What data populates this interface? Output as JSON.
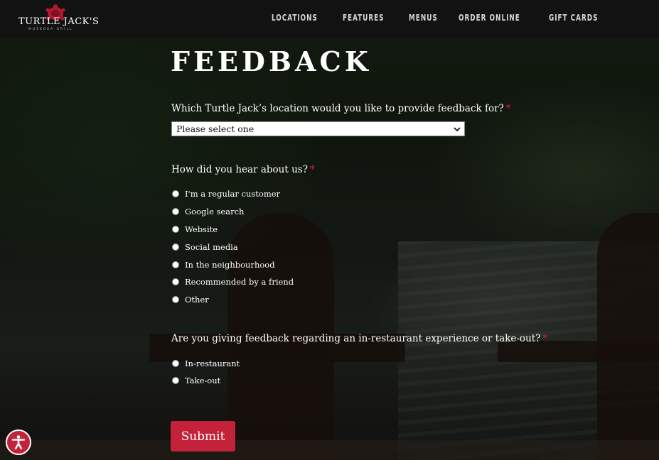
{
  "brand": {
    "name": "TURTLE JACK'S",
    "tagline": "MUSKOKA GRILL"
  },
  "nav": {
    "items": [
      {
        "label": "LOCATIONS"
      },
      {
        "label": "FEATURES"
      },
      {
        "label": "MENUS"
      },
      {
        "label": "ORDER ONLINE"
      },
      {
        "label": "GIFT CARDS"
      }
    ]
  },
  "form": {
    "title": "FEEDBACK",
    "location_question": {
      "label": "Which Turtle Jack’s location would you like to provide feedback for?",
      "required_mark": "*"
    },
    "location_select": {
      "value": "Please select one"
    },
    "hear_question": {
      "label": "How did you hear about us?",
      "required_mark": "*",
      "options": [
        {
          "label": "I'm a regular customer",
          "checked": false
        },
        {
          "label": "Google search",
          "checked": false
        },
        {
          "label": "Website",
          "checked": false
        },
        {
          "label": "Social media",
          "checked": false
        },
        {
          "label": "In the neighbourhood",
          "checked": false
        },
        {
          "label": "Recommended by a friend",
          "checked": false
        },
        {
          "label": "Other",
          "checked": false
        }
      ]
    },
    "experience_question": {
      "label": "Are you giving feedback regarding an in-restaurant experience or take-out?",
      "required_mark": "*",
      "options": [
        {
          "label": "In-restaurant",
          "checked": false
        },
        {
          "label": "Take-out",
          "checked": false
        }
      ]
    },
    "submit_label": "Submit"
  },
  "colors": {
    "accent": "#c4213a",
    "header_bg": "#121212",
    "required": "#d2203a"
  },
  "icons": {
    "accessibility": "accessibility-icon",
    "chevron": "chevron-down-icon",
    "logo": "turtle-logo-icon"
  }
}
